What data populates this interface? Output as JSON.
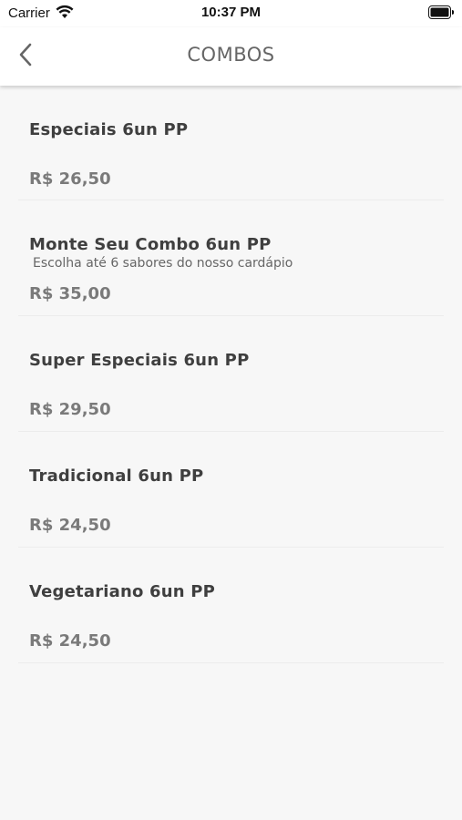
{
  "status_bar": {
    "carrier": "Carrier",
    "time": "10:37 PM",
    "wifi_icon": "wifi-icon",
    "battery_icon": "battery-icon"
  },
  "nav": {
    "title": "COMBOS",
    "back_icon": "chevron-left-icon"
  },
  "items": [
    {
      "name": "Especiais 6un PP",
      "description": "",
      "price": "R$ 26,50"
    },
    {
      "name": "Monte Seu Combo 6un PP",
      "description": "Escolha até 6 sabores do nosso cardápio",
      "price": "R$ 35,00"
    },
    {
      "name": "Super Especiais 6un PP",
      "description": "",
      "price": "R$ 29,50"
    },
    {
      "name": "Tradicional 6un PP",
      "description": "",
      "price": "R$ 24,50"
    },
    {
      "name": "Vegetariano 6un PP",
      "description": "",
      "price": "R$ 24,50"
    }
  ],
  "colors": {
    "background": "#f7f7f7",
    "header": "#ffffff",
    "title_text": "#666666",
    "price_text": "#7a7a7a"
  }
}
